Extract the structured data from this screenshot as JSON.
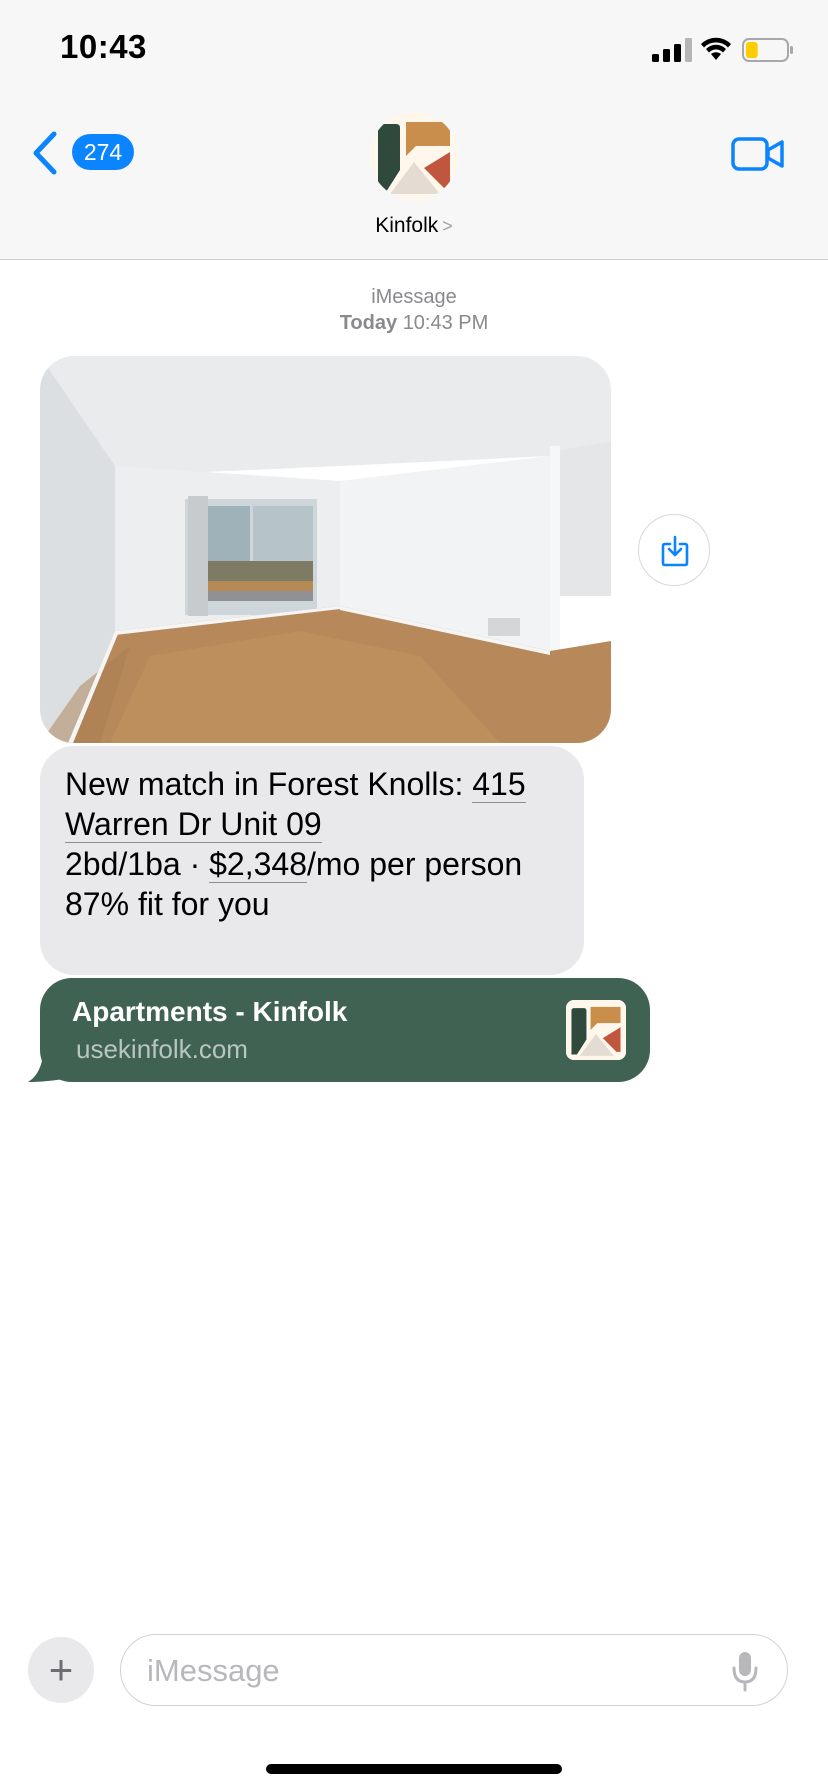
{
  "status_bar": {
    "time": "10:43",
    "battery_level_fraction": 0.3,
    "battery_color": "#ffcc00",
    "signal_icon": "cellular-signal-icon",
    "wifi_icon": "wifi-icon"
  },
  "header": {
    "back_count": "274",
    "contact_name": "Kinfolk",
    "name_chevron": ">",
    "back_icon": "chevron-left-icon",
    "video_icon": "video-camera-icon",
    "accent_color": "#0a84ff"
  },
  "conversation": {
    "service": "iMessage",
    "day": "Today",
    "time": "10:43 PM",
    "photo": {
      "description_icon": "apartment-photo"
    },
    "save_icon": "download-icon",
    "message": {
      "line1_prefix": "New match in Forest Knolls: ",
      "address_link": "415 Warren Dr Unit 09",
      "beds_baths": "2bd/1ba · ",
      "price_link": "$2,348",
      "price_suffix": "/mo per person",
      "fit": "87% fit for you"
    },
    "link_preview": {
      "title": "Apartments - Kinfolk",
      "domain": "usekinfolk.com",
      "background_color": "#406252"
    }
  },
  "composer": {
    "plus_label": "+",
    "placeholder": "iMessage",
    "mic_icon": "microphone-icon"
  }
}
